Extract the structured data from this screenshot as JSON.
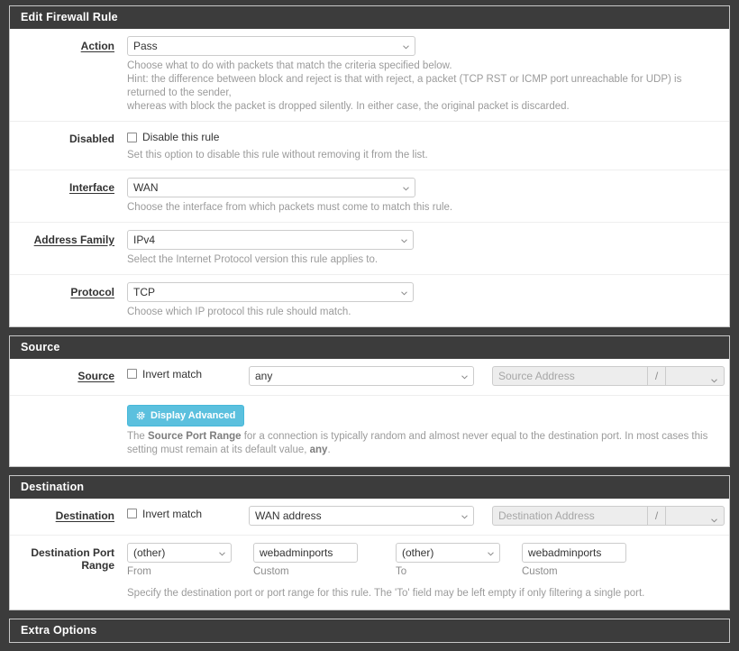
{
  "panels": {
    "rule": {
      "title": "Edit Firewall Rule",
      "fields": {
        "action": {
          "label": "Action",
          "value": "Pass",
          "help_line1": "Choose what to do with packets that match the criteria specified below.",
          "help_line2": "Hint: the difference between block and reject is that with reject, a packet (TCP RST or ICMP port unreachable for UDP) is returned to the sender,",
          "help_line3": "whereas with block the packet is dropped silently. In either case, the original packet is discarded."
        },
        "disabled": {
          "label": "Disabled",
          "checkbox_label": "Disable this rule",
          "help": "Set this option to disable this rule without removing it from the list."
        },
        "interface": {
          "label": "Interface",
          "value": "WAN",
          "help": "Choose the interface from which packets must come to match this rule."
        },
        "address_family": {
          "label": "Address Family",
          "value": "IPv4",
          "help": "Select the Internet Protocol version this rule applies to."
        },
        "protocol": {
          "label": "Protocol",
          "value": "TCP",
          "help": "Choose which IP protocol this rule should match."
        }
      }
    },
    "source": {
      "title": "Source",
      "fields": {
        "source": {
          "label": "Source",
          "invert_label": "Invert match",
          "type_value": "any",
          "address_placeholder": "Source Address",
          "slash": "/",
          "mask_value": ""
        },
        "advanced": {
          "button_label": "Display Advanced",
          "help_prefix": "The ",
          "help_bold1": "Source Port Range",
          "help_mid": " for a connection is typically random and almost never equal to the destination port. In most cases this setting must remain at its default value, ",
          "help_bold2": "any",
          "help_suffix": "."
        }
      }
    },
    "destination": {
      "title": "Destination",
      "fields": {
        "destination": {
          "label": "Destination",
          "invert_label": "Invert match",
          "type_value": "WAN address",
          "address_placeholder": "Destination Address",
          "slash": "/",
          "mask_value": ""
        },
        "port_range": {
          "label": "Destination Port Range",
          "from_select": "(other)",
          "from_sub": "From",
          "from_custom": "webadminports",
          "from_custom_sub": "Custom",
          "to_select": "(other)",
          "to_sub": "To",
          "to_custom": "webadminports",
          "to_custom_sub": "Custom",
          "help": "Specify the destination port or port range for this rule. The 'To' field may be left empty if only filtering a single port."
        }
      }
    },
    "extra": {
      "title": "Extra Options"
    }
  },
  "icons": {
    "caret": "chevron-down-icon",
    "gear": "gear-icon"
  },
  "colors": {
    "panel_heading_bg": "#3c3c3c",
    "page_bg": "#3c3c3c",
    "advanced_button": "#5bc0de",
    "help_text": "#9b9b9b"
  }
}
